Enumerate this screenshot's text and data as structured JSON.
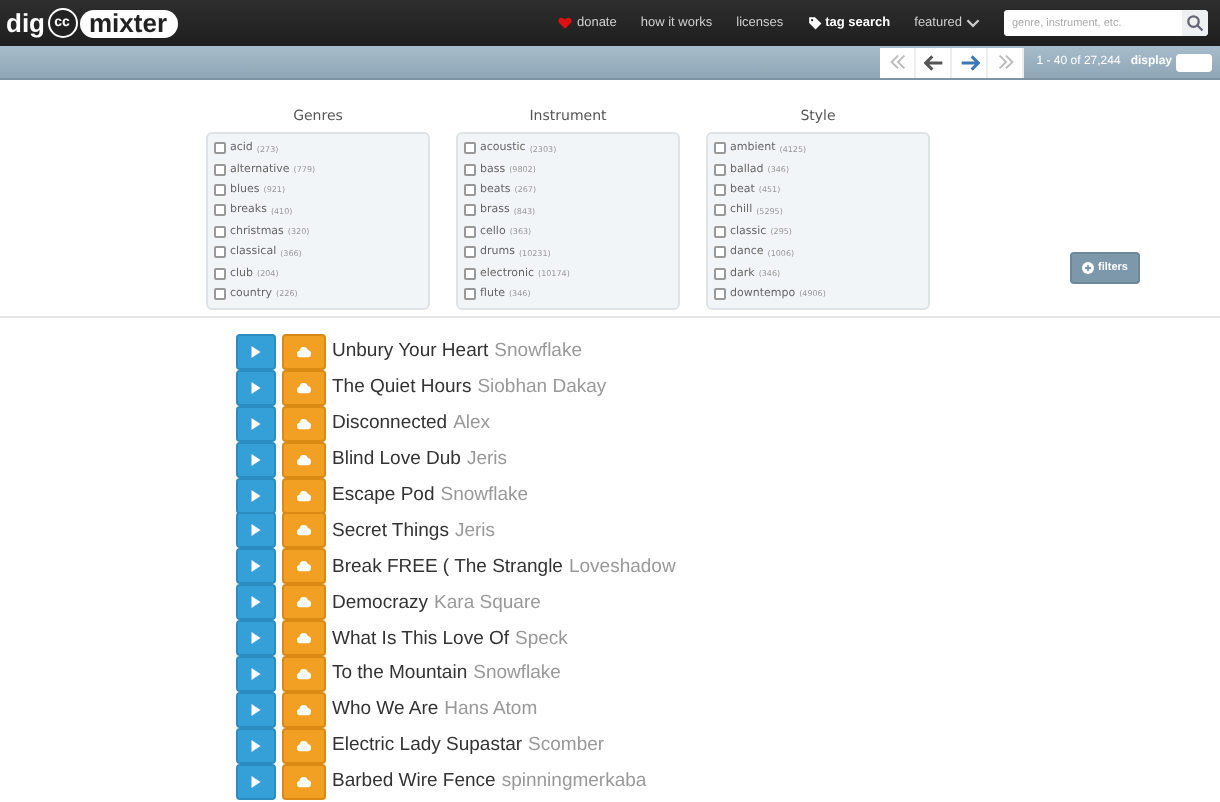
{
  "header": {
    "logo": {
      "left": "dig",
      "badge": "cc",
      "right": "mixter"
    },
    "nav": [
      {
        "label": "donate",
        "kind": "heart"
      },
      {
        "label": "how it works",
        "kind": "plain"
      },
      {
        "label": "licenses",
        "kind": "plain"
      },
      {
        "label": "tag search",
        "kind": "tag"
      },
      {
        "label": "featured",
        "kind": "dropdown"
      }
    ],
    "search": {
      "placeholder": "genre, instrument, etc."
    }
  },
  "pager": {
    "range": "1 - 40 of 27,244",
    "display_label": "display"
  },
  "filters": [
    {
      "title": "Genres",
      "items": [
        {
          "label": "acid",
          "count": "(273)",
          "checked": false
        },
        {
          "label": "alternative",
          "count": "(779)",
          "checked": false
        },
        {
          "label": "blues",
          "count": "(921)",
          "checked": false
        },
        {
          "label": "breaks",
          "count": "(410)",
          "checked": false
        },
        {
          "label": "christmas",
          "count": "(320)",
          "checked": false
        },
        {
          "label": "classical",
          "count": "(366)",
          "checked": false
        },
        {
          "label": "club",
          "count": "(204)",
          "checked": false
        },
        {
          "label": "country",
          "count": "(226)",
          "checked": false
        }
      ]
    },
    {
      "title": "Instrument",
      "items": [
        {
          "label": "acoustic",
          "count": "(2303)",
          "checked": false
        },
        {
          "label": "bass",
          "count": "(9802)",
          "checked": false
        },
        {
          "label": "beats",
          "count": "(267)",
          "checked": false
        },
        {
          "label": "brass",
          "count": "(843)",
          "checked": false
        },
        {
          "label": "cello",
          "count": "(363)",
          "checked": false
        },
        {
          "label": "drums",
          "count": "(10231)",
          "checked": false
        },
        {
          "label": "electronic",
          "count": "(10174)",
          "checked": false
        },
        {
          "label": "flute",
          "count": "(346)",
          "checked": false
        }
      ]
    },
    {
      "title": "Style",
      "items": [
        {
          "label": "ambient",
          "count": "(4125)",
          "checked": false
        },
        {
          "label": "ballad",
          "count": "(346)",
          "checked": false
        },
        {
          "label": "beat",
          "count": "(451)",
          "checked": false
        },
        {
          "label": "chill",
          "count": "(5295)",
          "checked": false
        },
        {
          "label": "classic",
          "count": "(295)",
          "checked": false
        },
        {
          "label": "dance",
          "count": "(1006)",
          "checked": false
        },
        {
          "label": "dark",
          "count": "(346)",
          "checked": false
        },
        {
          "label": "downtempo",
          "count": "(4906)",
          "checked": false
        }
      ]
    }
  ],
  "filters_button": "filters",
  "tracks": [
    {
      "title": "Unbury Your Heart",
      "artist": "Snowflake"
    },
    {
      "title": "The Quiet Hours",
      "artist": "Siobhan Dakay"
    },
    {
      "title": "Disconnected",
      "artist": "Alex"
    },
    {
      "title": "Blind Love Dub",
      "artist": "Jeris"
    },
    {
      "title": "Escape Pod",
      "artist": "Snowflake"
    },
    {
      "title": "Secret Things",
      "artist": "Jeris"
    },
    {
      "title": "Break FREE ( The Strangle",
      "artist": "Loveshadow"
    },
    {
      "title": "Democrazy",
      "artist": "Kara Square"
    },
    {
      "title": "What Is This Love Of",
      "artist": "Speck"
    },
    {
      "title": "To the Mountain",
      "artist": "Snowflake"
    },
    {
      "title": "Who We Are",
      "artist": "Hans Atom"
    },
    {
      "title": "Electric Lady Supastar",
      "artist": "Scomber"
    },
    {
      "title": "Barbed Wire Fence",
      "artist": "spinningmerkaba"
    }
  ]
}
